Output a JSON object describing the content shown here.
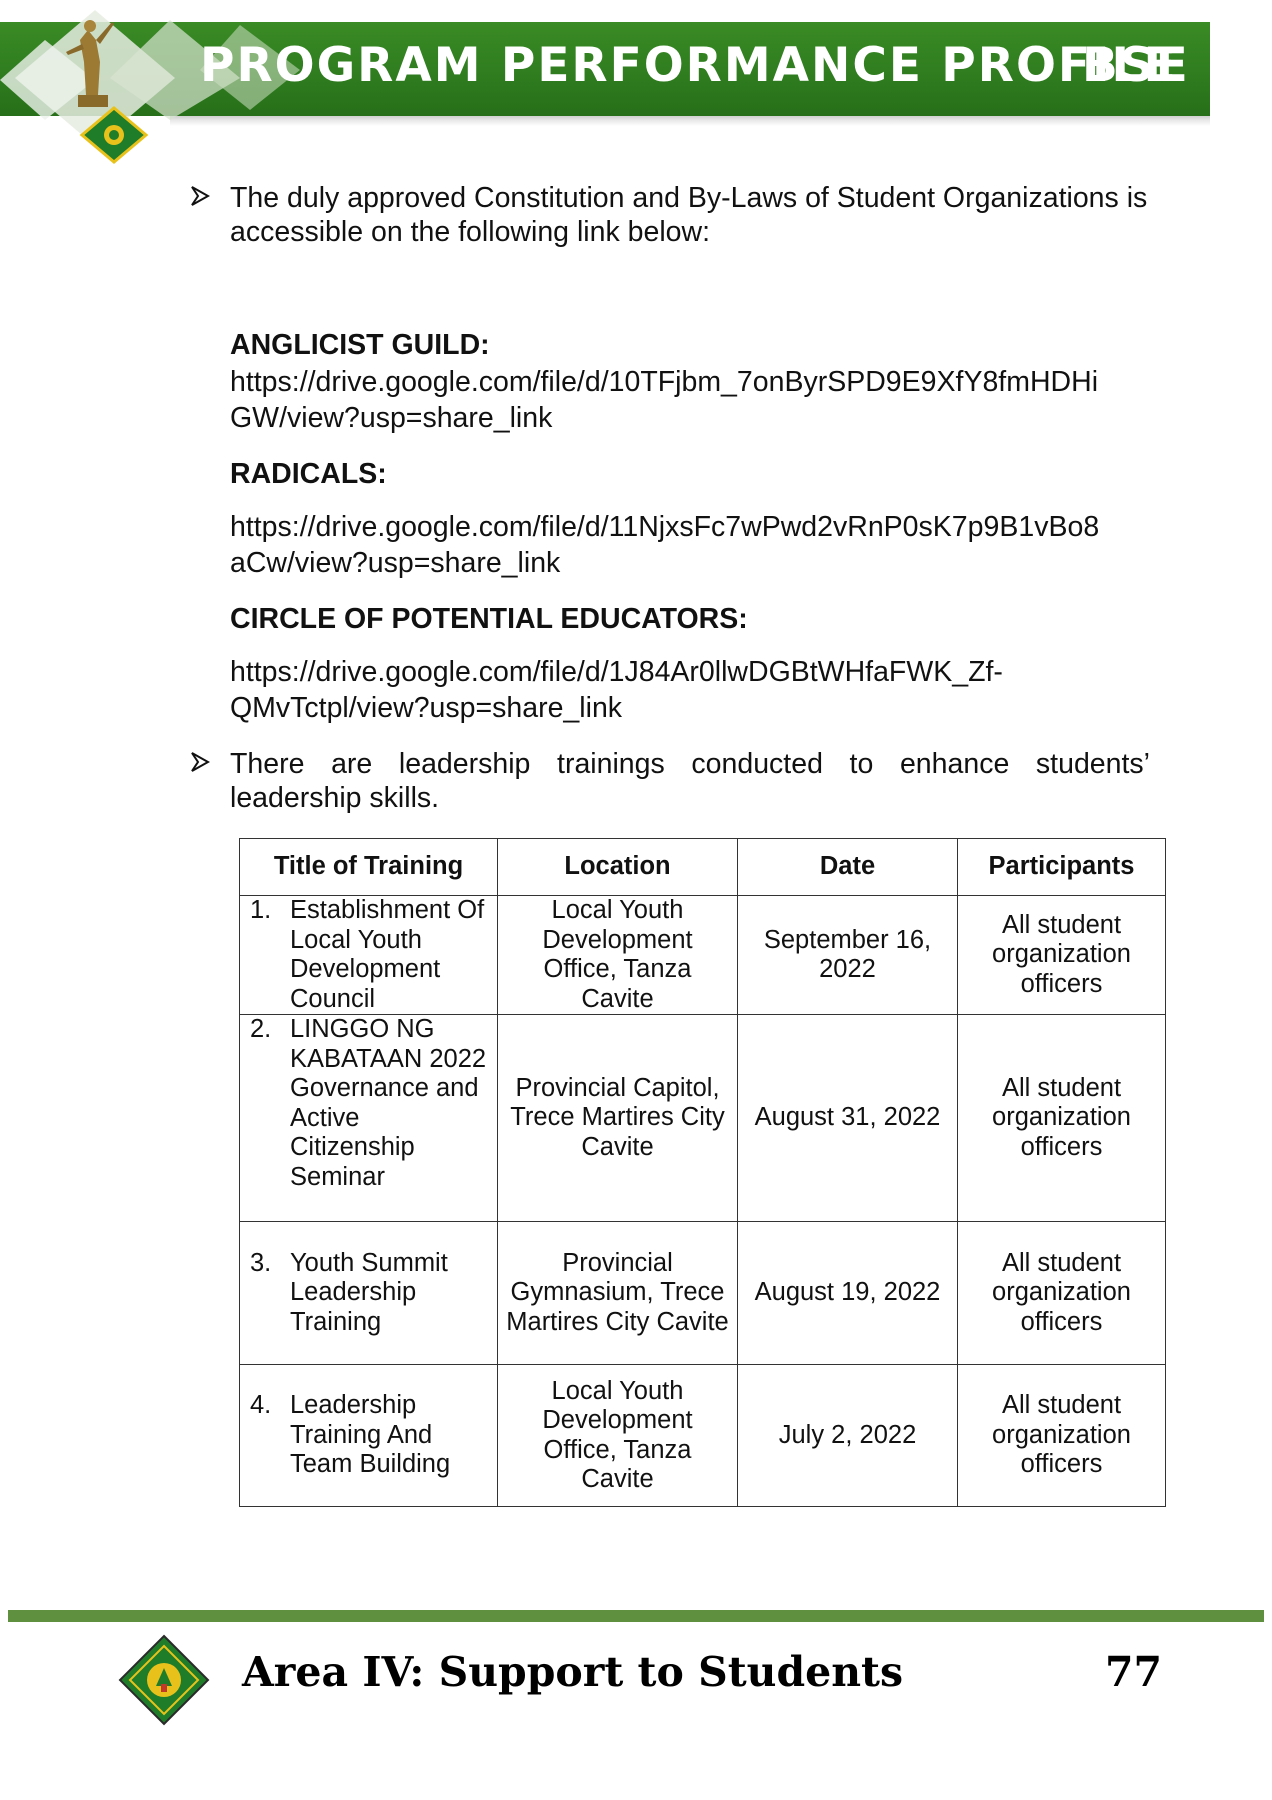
{
  "header": {
    "title": "PROGRAM PERFORMANCE PROFILE",
    "code": "BSE"
  },
  "intro": {
    "text": "The duly approved Constitution and By-Laws of Student Organizations is accessible on the following link below:"
  },
  "organizations": [
    {
      "name": "ANGLICIST GUILD:",
      "link_line1": "https://drive.google.com/file/d/10TFjbm_7onByrSPD9E9XfY8fmHDHi",
      "link_line2": "GW/view?usp=share_link"
    },
    {
      "name": "RADICALS:",
      "link_line1": "https://drive.google.com/file/d/11NjxsFc7wPwd2vRnP0sK7p9B1vBo8",
      "link_line2": "aCw/view?usp=share_link"
    },
    {
      "name": "CIRCLE OF POTENTIAL EDUCATORS:",
      "link_line1": "https://drive.google.com/file/d/1J84Ar0llwDGBtWHfaFWK_Zf-",
      "link_line2": "QMvTctpl/view?usp=share_link"
    }
  ],
  "leadership": {
    "line1": "There are leadership trainings conducted to enhance students’",
    "line2": "leadership skills."
  },
  "table": {
    "headers": [
      "Title of Training",
      "Location",
      "Date",
      "Participants"
    ],
    "rows": [
      {
        "num": "1.",
        "title": "Establishment Of Local Youth Development Council",
        "location": "Local Youth Development Office, Tanza Cavite",
        "date": "September 16, 2022",
        "participants": "All student organization officers"
      },
      {
        "num": "2.",
        "title": "LINGGO NG KABATAAN 2022 Governance and Active Citizenship Seminar",
        "location": "Provincial Capitol, Trece Martires City Cavite",
        "date": "August 31, 2022",
        "participants": "All student organization officers"
      },
      {
        "num": "3.",
        "title": "Youth Summit Leadership Training",
        "location": "Provincial Gymnasium, Trece Martires City Cavite",
        "date": "August 19, 2022",
        "participants": "All student organization officers"
      },
      {
        "num": "4.",
        "title": "Leadership Training And Team Building",
        "location": "Local Youth Development Office, Tanza Cavite",
        "date": "July 2, 2022",
        "participants": "All student organization officers"
      }
    ]
  },
  "footer": {
    "title": "Area IV: Support to Students",
    "page": "77"
  },
  "colors": {
    "banner_green": "#2f7d1f",
    "footer_bar": "#5e9040"
  }
}
